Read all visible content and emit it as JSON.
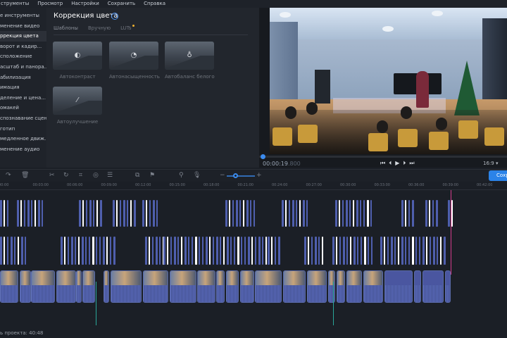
{
  "menu": [
    "струменты",
    "Просмотр",
    "Настройки",
    "Сохранить",
    "Справка"
  ],
  "tools": {
    "items": [
      {
        "label": "е инструменты",
        "active": false
      },
      {
        "label": "менение видео",
        "active": false
      },
      {
        "label": "ррекция цвета",
        "active": true
      },
      {
        "label": "ворот и кадир...",
        "active": false
      },
      {
        "label": "сположение",
        "active": false
      },
      {
        "label": "асштаб и панора...",
        "active": false
      },
      {
        "label": "абилизация",
        "active": false
      },
      {
        "label": "имация",
        "active": false
      },
      {
        "label": "деление и цена...",
        "active": false
      },
      {
        "label": "омакей",
        "active": false
      },
      {
        "label": "спознавание сцен",
        "active": false
      },
      {
        "label": "готип",
        "active": false
      },
      {
        "label": "медленное движ...",
        "active": false
      },
      {
        "label": "менение аудио",
        "active": false
      }
    ]
  },
  "panel": {
    "title": "Коррекция цвета",
    "help": "?",
    "tabs": [
      {
        "label": "Шаблоны",
        "active": true
      },
      {
        "label": "Вручную",
        "active": false
      },
      {
        "label": "LUTs",
        "active": false,
        "new_dot": true
      }
    ],
    "presets": [
      {
        "label": "Автоконтраст",
        "icon": "contrast-icon",
        "glyph": "◐"
      },
      {
        "label": "Автонасыщенность",
        "icon": "saturation-icon",
        "glyph": "◔"
      },
      {
        "label": "Автобаланс белого",
        "icon": "lightbulb-icon",
        "glyph": "♁"
      },
      {
        "label": "Автоулучшение",
        "icon": "magic-wand-icon",
        "glyph": "⁄"
      }
    ]
  },
  "player": {
    "timecode": "00:00:19",
    "timecode_ms": ".800",
    "progress_fraction": 0.006,
    "aspect": "16:9 ▾",
    "controls": [
      {
        "name": "skip-start-icon",
        "glyph": "⏮"
      },
      {
        "name": "prev-frame-icon",
        "glyph": "⏴"
      },
      {
        "name": "play-icon",
        "glyph": "▶"
      },
      {
        "name": "next-frame-icon",
        "glyph": "⏵"
      },
      {
        "name": "skip-end-icon",
        "glyph": "⏭"
      }
    ]
  },
  "toolbar": {
    "save_label": "Сохранить",
    "icons": [
      {
        "name": "redo-icon",
        "glyph": "↷"
      },
      {
        "name": "delete-icon",
        "glyph": "🗑"
      },
      {
        "name": "cut-icon",
        "glyph": "✂"
      },
      {
        "name": "rotate-icon",
        "glyph": "↻"
      },
      {
        "name": "crop-icon",
        "glyph": "⌗"
      },
      {
        "name": "color-icon",
        "glyph": "◎"
      },
      {
        "name": "adjust-icon",
        "glyph": "☰"
      },
      {
        "name": "insert-icon",
        "glyph": "⧉"
      },
      {
        "name": "flag-icon",
        "glyph": "⚑"
      },
      {
        "name": "marker-icon",
        "glyph": "⚲"
      },
      {
        "name": "mic-icon",
        "glyph": "🎙"
      },
      {
        "name": "zoom-out-icon",
        "glyph": "−"
      },
      {
        "name": "zoom-in-icon",
        "glyph": "+"
      }
    ]
  },
  "ruler": [
    "00:00",
    "00:03:00",
    "00:06:00",
    "00:09:00",
    "00:12:00",
    "00:15:00",
    "00:18:00",
    "00:21:00",
    "00:24:00",
    "00:27:00",
    "00:30:00",
    "00:33:00",
    "00:36:00",
    "00:39:00",
    "00:42:00"
  ],
  "status": {
    "text": "ь проекта: 40:48"
  }
}
